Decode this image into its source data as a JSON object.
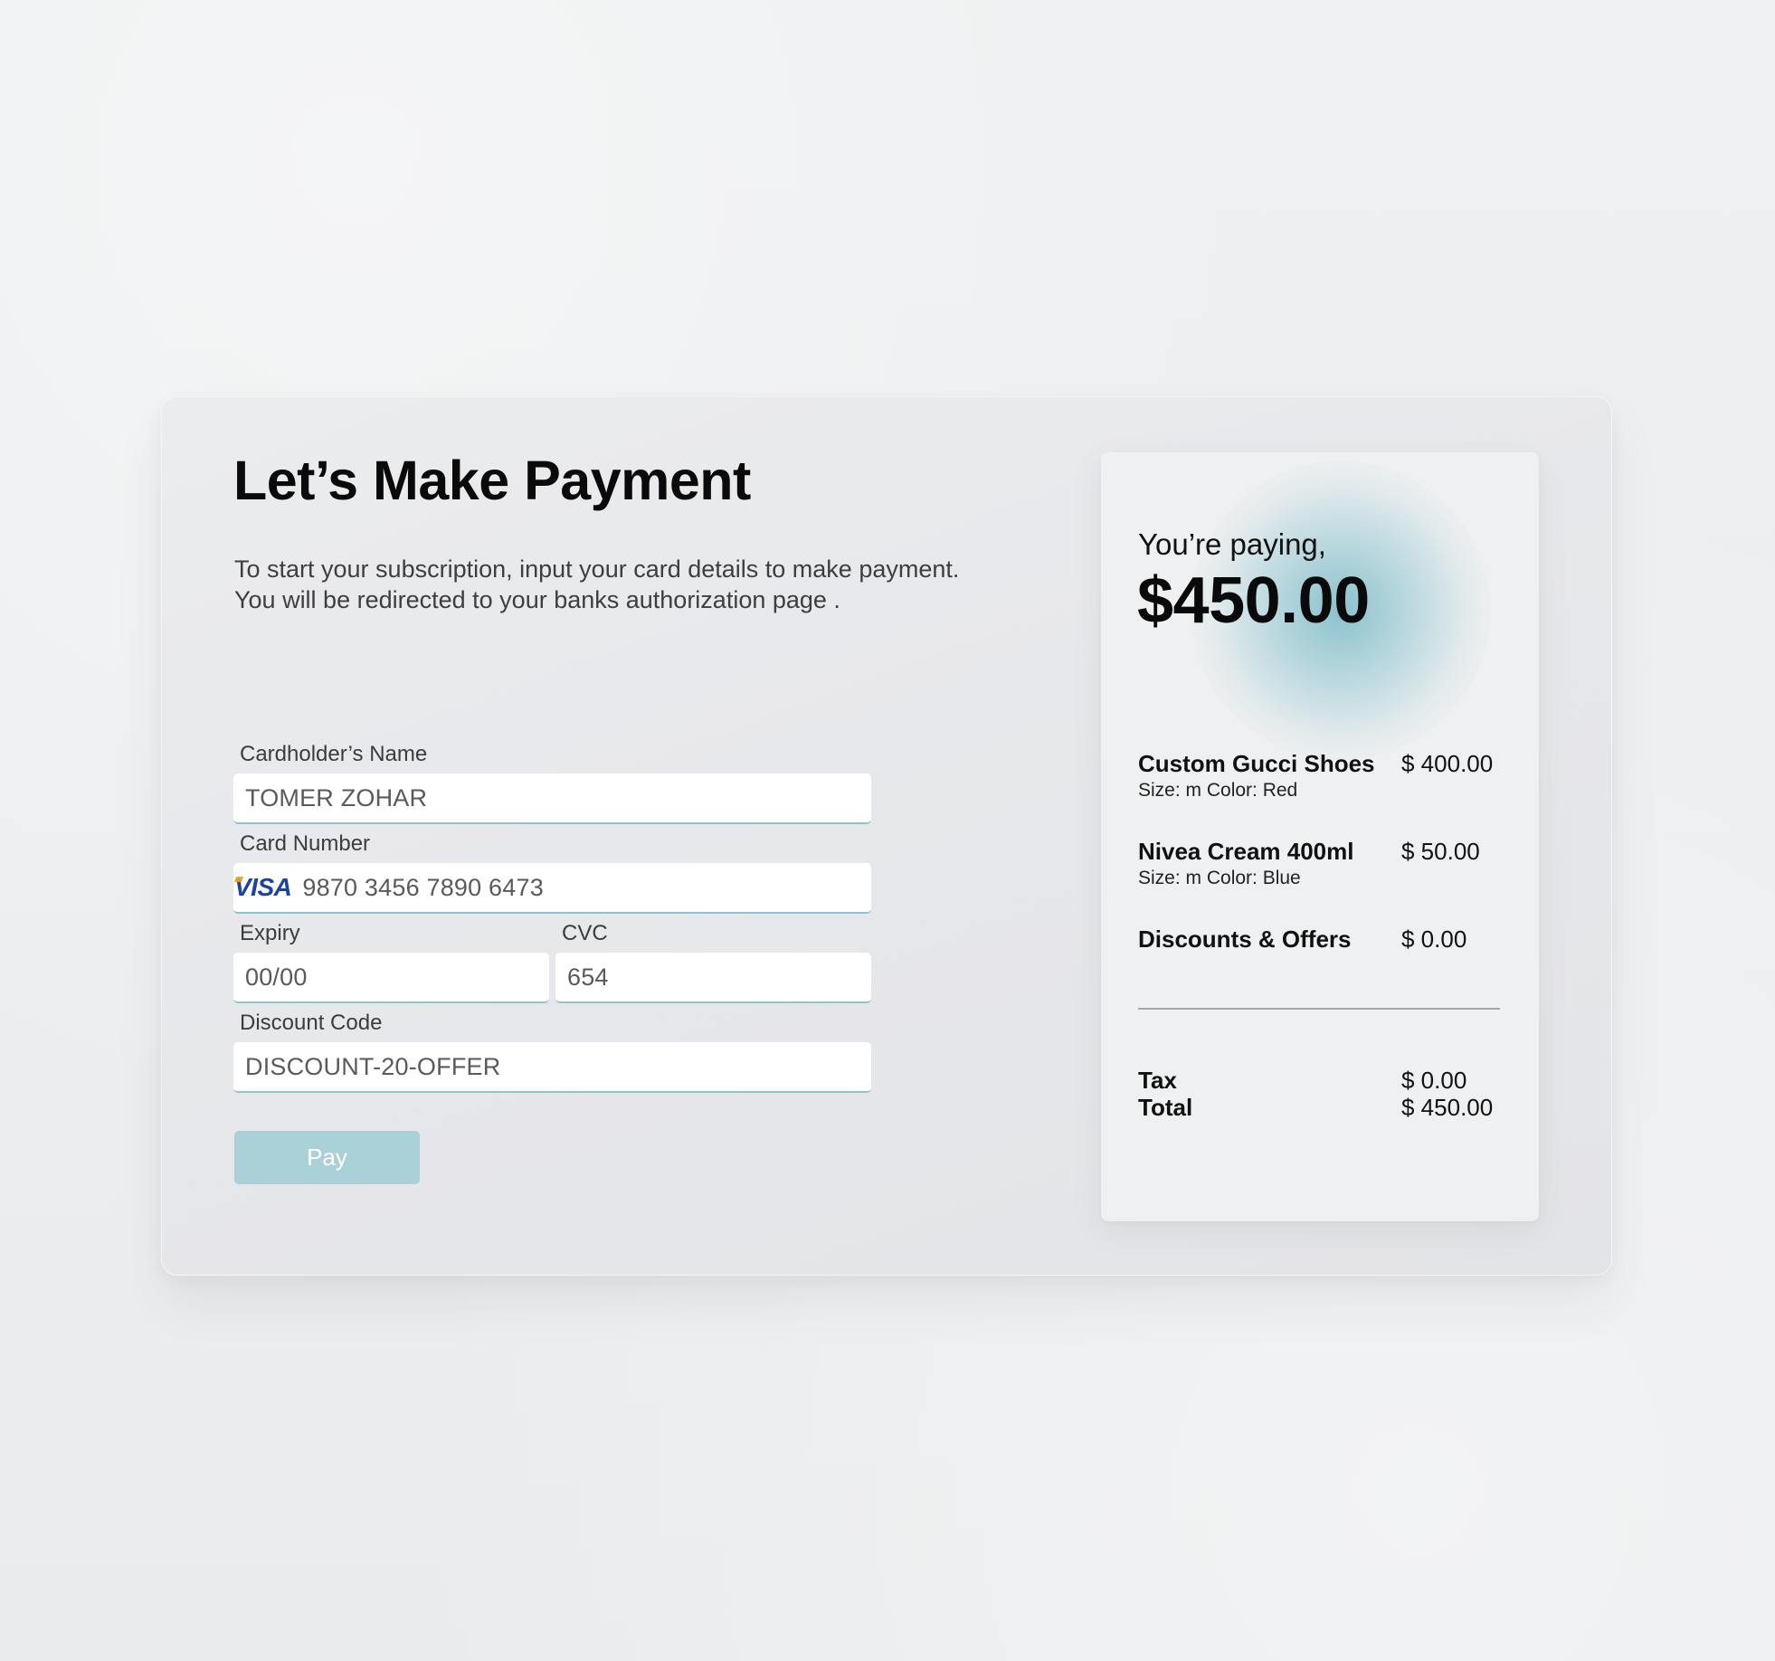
{
  "payment": {
    "title": "Let’s Make Payment",
    "intro": "To start your subscription, input your card details to make payment. You will be redirected to your banks authorization page .",
    "fields": {
      "cardholder": {
        "label": "Cardholder’s Name",
        "value": "TOMER ZOHAR"
      },
      "card_number": {
        "label": "Card Number",
        "value": "9870 3456 7890 6473",
        "brand": "VISA"
      },
      "expiry": {
        "label": "Expiry",
        "value": "00/00"
      },
      "cvc": {
        "label": "CVC",
        "value": "654"
      },
      "discount": {
        "label": "Discount Code",
        "value": "DISCOUNT-20-OFFER"
      }
    },
    "pay_label": "Pay"
  },
  "summary": {
    "paying_label": "You’re paying,",
    "amount": "$450.00",
    "items": [
      {
        "name": "Custom Gucci Shoes",
        "meta": "Size: m Color: Red",
        "price": "$ 400.00"
      },
      {
        "name": "Nivea Cream 400ml",
        "meta": "Size: m Color: Blue",
        "price": "$ 50.00"
      },
      {
        "name": "Discounts & Offers",
        "price": "$ 0.00"
      }
    ],
    "tax": {
      "label": "Tax",
      "value": "$ 0.00"
    },
    "total": {
      "label": "Total",
      "value": "$ 450.00"
    }
  },
  "colors": {
    "accent": "#8fc3cd",
    "button": "#abd1d8",
    "visa": "#1a44a0"
  }
}
